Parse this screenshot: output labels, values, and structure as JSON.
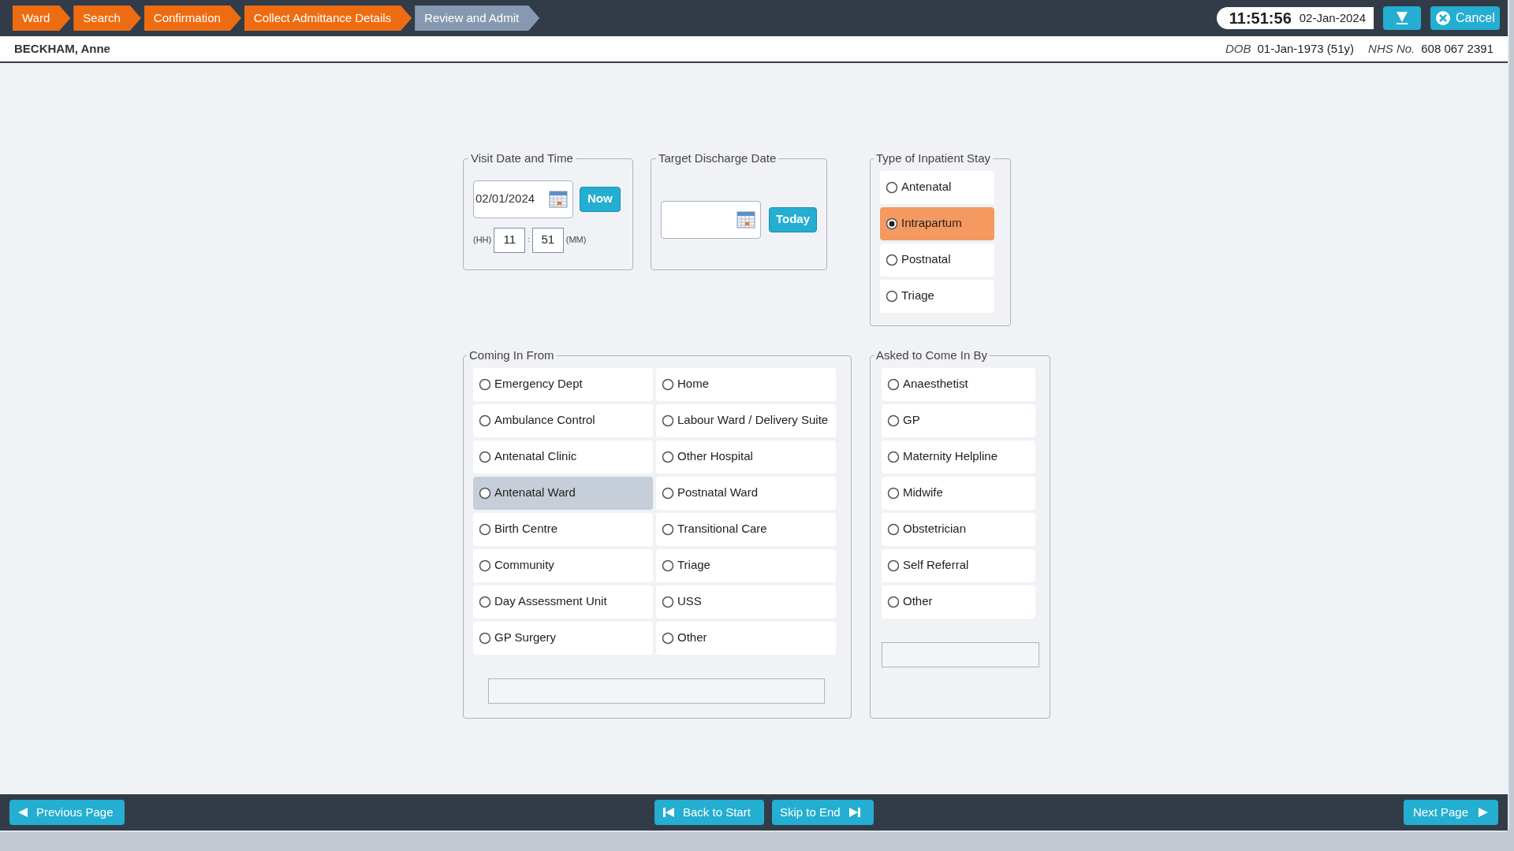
{
  "breadcrumbs": [
    {
      "label": "Ward",
      "completed": true
    },
    {
      "label": "Search",
      "completed": true
    },
    {
      "label": "Confirmation",
      "completed": true
    },
    {
      "label": "Collect Admittance Details",
      "completed": true
    },
    {
      "label": "Review and Admit",
      "completed": false
    }
  ],
  "header": {
    "time": "11:51:56",
    "date": "02-Jan-2024",
    "cancel_label": "Cancel"
  },
  "patient": {
    "name": "BECKHAM, Anne",
    "dob_label": "DOB",
    "dob": "01-Jan-1973 (51y)",
    "nhs_label": "NHS No.",
    "nhs": "608 067 2391"
  },
  "visit": {
    "legend": "Visit Date and Time",
    "date_value": "02/01/2024",
    "now_label": "Now",
    "hh_label": "(HH)",
    "hour": "11",
    "separator": ":",
    "minute": "51",
    "mm_label": "(MM)"
  },
  "discharge": {
    "legend": "Target Discharge Date",
    "today_label": "Today"
  },
  "inpatient_type": {
    "legend": "Type of Inpatient Stay",
    "options": [
      {
        "label": "Antenatal",
        "selected": false
      },
      {
        "label": "Intrapartum",
        "selected": true
      },
      {
        "label": "Postnatal",
        "selected": false
      },
      {
        "label": "Triage",
        "selected": false
      }
    ]
  },
  "coming_in_from": {
    "legend": "Coming In From",
    "options": [
      {
        "label": "Emergency Dept",
        "selected": false,
        "highlighted": false
      },
      {
        "label": "Home",
        "selected": false,
        "highlighted": false
      },
      {
        "label": "Ambulance Control",
        "selected": false,
        "highlighted": false
      },
      {
        "label": "Labour Ward / Delivery Suite",
        "selected": false,
        "highlighted": false
      },
      {
        "label": "Antenatal Clinic",
        "selected": false,
        "highlighted": false
      },
      {
        "label": "Other Hospital",
        "selected": false,
        "highlighted": false
      },
      {
        "label": "Antenatal Ward",
        "selected": false,
        "highlighted": true
      },
      {
        "label": "Postnatal Ward",
        "selected": false,
        "highlighted": false
      },
      {
        "label": "Birth Centre",
        "selected": false,
        "highlighted": false
      },
      {
        "label": "Transitional Care",
        "selected": false,
        "highlighted": false
      },
      {
        "label": "Community",
        "selected": false,
        "highlighted": false
      },
      {
        "label": "Triage",
        "selected": false,
        "highlighted": false
      },
      {
        "label": "Day Assessment Unit",
        "selected": false,
        "highlighted": false
      },
      {
        "label": "USS",
        "selected": false,
        "highlighted": false
      },
      {
        "label": "GP Surgery",
        "selected": false,
        "highlighted": false
      },
      {
        "label": "Other",
        "selected": false,
        "highlighted": false
      }
    ]
  },
  "asked_by": {
    "legend": "Asked to Come In By",
    "options": [
      {
        "label": "Anaesthetist",
        "selected": false
      },
      {
        "label": "GP",
        "selected": false
      },
      {
        "label": "Maternity Helpline",
        "selected": false
      },
      {
        "label": "Midwife",
        "selected": false
      },
      {
        "label": "Obstetrician",
        "selected": false
      },
      {
        "label": "Self Referral",
        "selected": false
      },
      {
        "label": "Other",
        "selected": false
      }
    ]
  },
  "footer": {
    "previous": "Previous Page",
    "back": "Back to Start",
    "skip": "Skip to End",
    "next": "Next Page"
  }
}
